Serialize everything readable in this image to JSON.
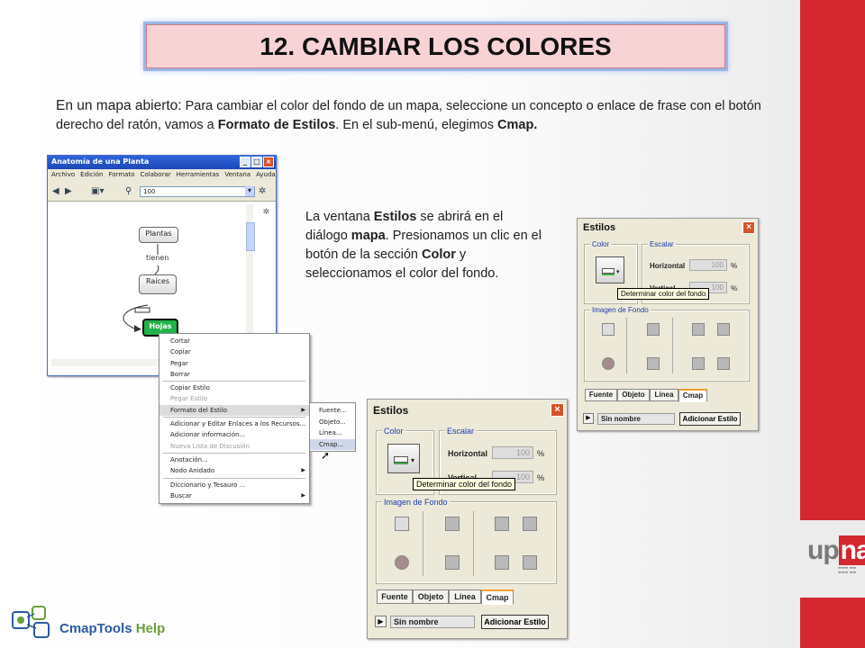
{
  "slide": {
    "title": "12. CAMBIAR LOS COLORES",
    "intro_lead": "En un mapa abierto:",
    "intro_rest": " Para cambiar el color del fondo de un mapa, seleccione un concepto o enlace de frase con el botón derecho del ratón, vamos a ",
    "intro_b1": "Formato de Estilos",
    "intro_mid": ". En el sub-menú, elegimos ",
    "intro_b2": "Cmap.",
    "desc_1": "La ventana ",
    "desc_b1": "Estilos",
    "desc_2": " se abrirá en el diálogo ",
    "desc_b2": "mapa",
    "desc_3": ". Presionamos un clic en el botón de la sección ",
    "desc_b3": "Color",
    "desc_4": "  y seleccionamos el color del fondo.",
    "footer_logo_text": "CmapTools",
    "footer_logo_help": "Help",
    "upna_logo_up": "up",
    "upna_logo_na": "na",
    "colors": {
      "accent_red": "#d3282f",
      "title_bg": "#f8d3d6",
      "title_glow": "#9bb5e6"
    }
  },
  "main_window": {
    "title": "Anatomía de una Planta",
    "menu": [
      "Archivo",
      "Edición",
      "Formato",
      "Colaborar",
      "Herramientas",
      "Ventana",
      "Ayuda"
    ],
    "zoom_value": "100",
    "nodes": {
      "n1": "Plantas",
      "n2": "Raíces",
      "n3": "Hojas"
    },
    "link_text": "tienen",
    "icons": [
      "back-arrow-icon",
      "forward-arrow-icon",
      "view-icon",
      "zoom-icon",
      "gear-icon"
    ]
  },
  "context_menu": {
    "items": [
      {
        "label": "Cortar",
        "disabled": false
      },
      {
        "label": "Copiar",
        "disabled": false
      },
      {
        "label": "Pegar",
        "disabled": false
      },
      {
        "label": "Borrar",
        "disabled": false
      },
      {
        "label": "Copiar Estilo",
        "disabled": false
      },
      {
        "label": "Pegar Estilo",
        "disabled": true
      },
      {
        "label": "Formato del Estilo",
        "disabled": false
      },
      {
        "label": "Adicionar y Editar Enlaces a los Recursos...",
        "disabled": false
      },
      {
        "label": "Adicionar información...",
        "disabled": false
      },
      {
        "label": "Nueva Lista de Discusión",
        "disabled": true
      },
      {
        "label": "Anotación...",
        "disabled": false
      },
      {
        "label": "Nodo Anidado",
        "disabled": false
      },
      {
        "label": "Diccionario y Tesauro ...",
        "disabled": false
      },
      {
        "label": "Buscar",
        "disabled": false
      }
    ],
    "submenu": [
      "Fuente...",
      "Objeto...",
      "Línea...",
      "Cmap..."
    ]
  },
  "estilos_dialog": {
    "title": "Estilos",
    "group_color": "Color",
    "group_scale": "Escalar",
    "horizontal": "Horizontal",
    "vertical": "Vertical",
    "value_h": "100",
    "value_v": "100",
    "percent": "%",
    "tooltip": "Determinar color del fondo",
    "group_image": "Imagen de Fondo",
    "tabs": [
      "Fuente",
      "Objeto",
      "Línea",
      "Cmap"
    ],
    "active_tab": "Cmap",
    "name_value": "Sin nombre",
    "add_button": "Adicionar Estilo",
    "play_icon": "play-icon",
    "close_icon": "close-icon"
  }
}
